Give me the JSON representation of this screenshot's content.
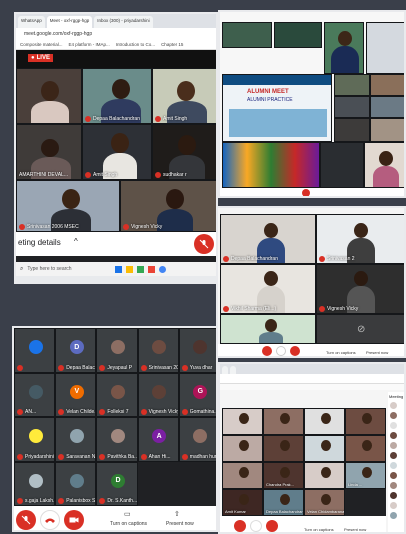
{
  "top_left_window": {
    "tabs": [
      "WhatsApp",
      "Meet - oxf-rggp-hgp",
      "Inbox (300) - priyadarshini"
    ],
    "url": "meet.google.com/oxf-rggp-hgp",
    "bookmarks": [
      "Composite material...",
      "E4 platform - IMAp...",
      "Introduction to Co...",
      "Chapter 15"
    ],
    "live_label": "LIVE",
    "tiles": [
      {
        "name": ""
      },
      {
        "name": "Depaa Balachandran"
      },
      {
        "name": "Amit Singh"
      },
      {
        "name": "AMARTHINI DEVAL..."
      },
      {
        "name": "Amit Singh"
      },
      {
        "name": "sudhakar r"
      },
      {
        "name": "Srinivasan 2006 MSEC"
      },
      {
        "name": "Vignesh Vicky"
      }
    ],
    "meeting_details": "eting details",
    "search_placeholder": "Type here to search"
  },
  "top_right_window": {
    "poster_lines": [
      "ALUMNI MEET",
      "ALUMNI PRACTICE"
    ],
    "participants_note": ""
  },
  "middle_right_window": {
    "tiles": [
      {
        "name": "Depaa Balachandran"
      },
      {
        "name": "Srinivasan 2"
      },
      {
        "name": "Vikhil Sharma (Eli...)"
      },
      {
        "name": "Vignesh Vicky"
      }
    ],
    "turn_on_captions": "Turn on captions",
    "present_now": "Present now"
  },
  "bottom_left_window": {
    "tiles": [
      {
        "name": "",
        "initial": "",
        "color": "#1a73e8"
      },
      {
        "name": "Depaa Balac...",
        "initial": "D",
        "color": "#5c6bc0"
      },
      {
        "name": "Jeyapaul P",
        "initial": "",
        "color": "#8d6e63"
      },
      {
        "name": "Srinivasan 20...",
        "initial": "",
        "color": "#6d4c41"
      },
      {
        "name": "Yuva dhar",
        "initial": "",
        "color": "#4e342e"
      },
      {
        "name": "AN...",
        "initial": "",
        "color": "#455a64"
      },
      {
        "name": "Velan Childe...",
        "initial": "V",
        "color": "#ef6c00"
      },
      {
        "name": "Folleksi 7",
        "initial": "",
        "color": "#795548"
      },
      {
        "name": "Vignesh Vicky",
        "initial": "",
        "color": "#5d4037"
      },
      {
        "name": "Gomathina...",
        "initial": "G",
        "color": "#ad1457"
      },
      {
        "name": "Priyadarshini...",
        "initial": "",
        "color": "#ffeb3b"
      },
      {
        "name": "Saravanan N...",
        "initial": "",
        "color": "#90a4ae"
      },
      {
        "name": "Pavithka Ba...",
        "initial": "",
        "color": "#a1887f"
      },
      {
        "name": "Ahan Hi...",
        "initial": "A",
        "color": "#7b1fa2"
      },
      {
        "name": "madhan hunk",
        "initial": "",
        "color": "#8d6e63"
      },
      {
        "name": "s.gaja Laksh...",
        "initial": "",
        "color": "#b0bec5"
      },
      {
        "name": "Palanisbox S...",
        "initial": "",
        "color": "#607d8b"
      },
      {
        "name": "Dr. S.Kanth...",
        "initial": "D",
        "color": "#2e7d32"
      }
    ],
    "turn_on_captions": "Turn on captions",
    "present_now": "Present now"
  },
  "bottom_right_window": {
    "tiles": [
      {
        "name": ""
      },
      {
        "name": ""
      },
      {
        "name": ""
      },
      {
        "name": ""
      },
      {
        "name": ""
      },
      {
        "name": ""
      },
      {
        "name": ""
      },
      {
        "name": ""
      },
      {
        "name": ""
      },
      {
        "name": "Chandra Prak..."
      },
      {
        "name": ""
      },
      {
        "name": "Linda ..."
      },
      {
        "name": "Amit Kumar"
      },
      {
        "name": "Depaa Balachandran"
      },
      {
        "name": "Velan Chidambaranathan"
      }
    ],
    "turn_on_captions": "Turn on captions",
    "present_now": "Present now",
    "meeting_label": "Meeting"
  }
}
